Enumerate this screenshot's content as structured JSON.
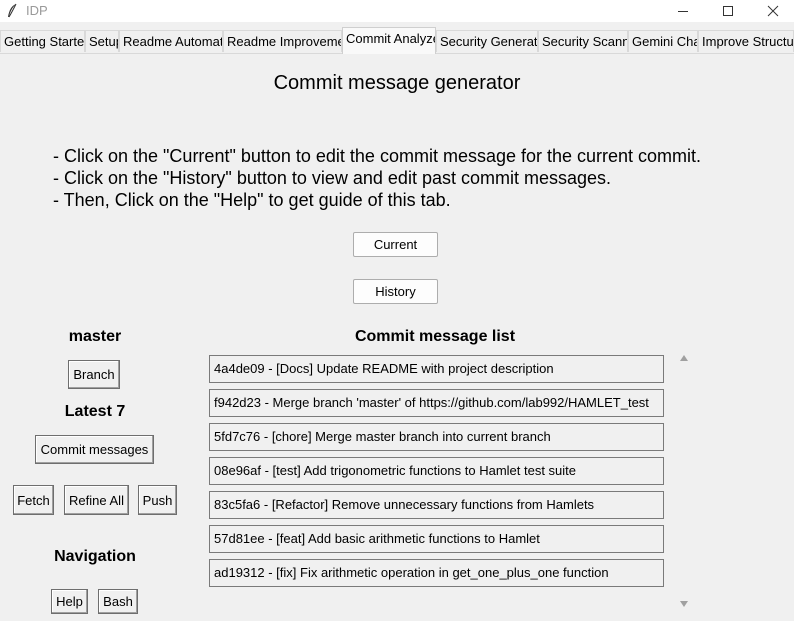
{
  "window": {
    "title": "IDP"
  },
  "tabs": [
    {
      "label": "Getting Started"
    },
    {
      "label": "Setup"
    },
    {
      "label": "Readme Automation"
    },
    {
      "label": "Readme Improvement"
    },
    {
      "label": "Commit Analyzer"
    },
    {
      "label": "Security Generator"
    },
    {
      "label": "Security Scanner"
    },
    {
      "label": "Gemini Chat"
    },
    {
      "label": "Improve Structure"
    }
  ],
  "main": {
    "heading": "Commit message generator",
    "instructions": [
      "- Click on the \"Current\" button to edit the commit message for the current commit.",
      "- Click on the \"History\" button to view and edit past commit messages.",
      "- Then, Click on the \"Help\" to get guide of this tab."
    ],
    "current_label": "Current",
    "history_label": "History"
  },
  "left_panel": {
    "branch_name": "master",
    "branch_button": "Branch",
    "latest_label": "Latest 7",
    "commit_messages_button": "Commit messages",
    "fetch_button": "Fetch",
    "refine_all_button": "Refine All",
    "push_button": "Push",
    "navigation_label": "Navigation",
    "help_button": "Help",
    "bash_button": "Bash"
  },
  "commit_list": {
    "title": "Commit message list",
    "items": [
      "4a4de09 - [Docs] Update README with project description",
      "f942d23 - Merge branch 'master' of https://github.com/lab992/HAMLET_test",
      "5fd7c76 - [chore] Merge master branch into current branch",
      "08e96af - [test] Add trigonometric functions to Hamlet test suite",
      "83c5fa6 - [Refactor] Remove unnecessary functions from Hamlets",
      "57d81ee - [feat] Add basic arithmetic functions to Hamlet",
      "ad19312 - [fix] Fix arithmetic operation in get_one_plus_one function"
    ]
  }
}
